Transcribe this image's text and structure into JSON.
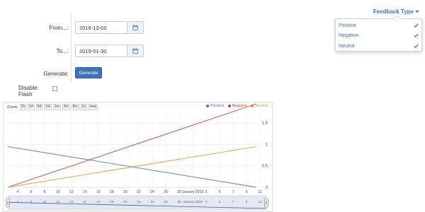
{
  "form": {
    "from_label": "From...:",
    "from_value": "2018-12-02",
    "to_label": "To...:",
    "to_value": "2019-01-30",
    "generate_label": "Generate:",
    "generate_button": "Generate",
    "disable_flash_label": "Disable Flash",
    "disable_flash_checked": false
  },
  "feedback": {
    "toggle_label": "Feedback Type",
    "items": [
      {
        "label": "Positive",
        "checked": true
      },
      {
        "label": "Negative",
        "checked": true
      },
      {
        "label": "Neutral",
        "checked": true
      }
    ]
  },
  "chart": {
    "zoom_label": "Zoom:",
    "zoom_buttons": [
      "1h",
      "1d",
      "5d",
      "1w",
      "1m",
      "3m",
      "6m",
      "1y",
      "max"
    ],
    "legend": [
      {
        "label": "Positive",
        "color": "#4a74c9"
      },
      {
        "label": "Negative",
        "color": "#c9432f"
      },
      {
        "label": "Neutral",
        "color": "#e49b2d"
      }
    ],
    "y_ticks": [
      "1.5",
      "1",
      "0.5",
      "0"
    ],
    "x_ticks": [
      "4",
      "6",
      "8",
      "10",
      "12",
      "14",
      "16",
      "18",
      "20",
      "22",
      "24",
      "26",
      "28",
      "January 2019",
      "3",
      "5",
      "7",
      "9",
      "11"
    ],
    "navigator_ticks": [
      "4",
      "6",
      "8",
      "10",
      "12",
      "14",
      "16",
      "18",
      "20",
      "22",
      "24",
      "26",
      "28",
      "January 2019",
      "3",
      "5",
      "7",
      "9",
      "11"
    ]
  },
  "chart_data": {
    "type": "line",
    "title": "",
    "xlabel": "",
    "ylabel": "",
    "ylim": [
      0,
      1.75
    ],
    "x": [
      "2018-12-02",
      "2019-01-12"
    ],
    "series": [
      {
        "name": "Positive",
        "color": "#4a74c9",
        "values": [
          0.95,
          0.0
        ]
      },
      {
        "name": "Negative",
        "color": "#c9432f",
        "values": [
          0.0,
          1.95
        ]
      },
      {
        "name": "Neutral",
        "color": "#e49b2d",
        "values": [
          0.0,
          0.95
        ]
      }
    ],
    "grid": true,
    "legend_position": "top-right"
  }
}
